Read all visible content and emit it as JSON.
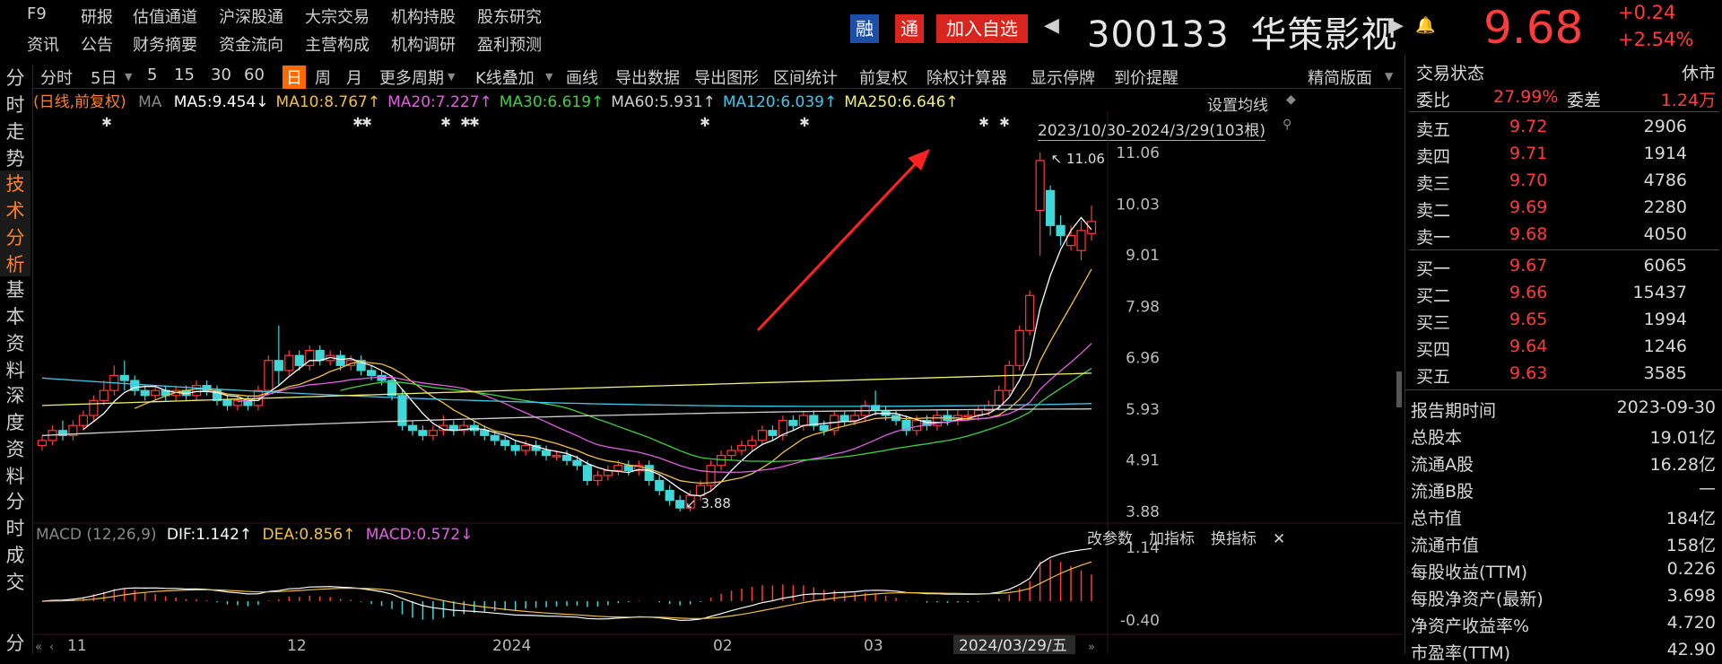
{
  "topnav": {
    "row1": [
      "F9",
      "研报",
      "估值通道",
      "沪深股通",
      "大宗交易",
      "机构持股",
      "股东研究"
    ],
    "row2": [
      "资讯",
      "公告",
      "财务摘要",
      "资金流向",
      "主营构成",
      "机构调研",
      "盈利预测"
    ]
  },
  "header": {
    "rong": "融",
    "tong": "通",
    "add_watch": "加入自选",
    "prev": "◀",
    "next": "▶",
    "bell": "🔔",
    "code": "300133",
    "name": "华策影视",
    "price": "9.68",
    "change": "+0.24",
    "change_pct": "+2.54%"
  },
  "lefttabs": [
    {
      "label": "分\n时\n走\n势",
      "active": false
    },
    {
      "label": "技\n术\n分\n析",
      "active": true
    },
    {
      "label": "基\n本\n资\n料",
      "active": false
    },
    {
      "label": "深\n度\n资\n料",
      "active": false
    },
    {
      "label": "分\n时\n成\n交",
      "active": false
    },
    {
      "label": "分",
      "active": false
    }
  ],
  "toolbar": {
    "items": [
      "分时",
      "5日",
      "5",
      "15",
      "30",
      "60",
      "日",
      "周",
      "月",
      "更多周期",
      "K线叠加",
      "画线",
      "导出数据",
      "导出图形",
      "区间统计",
      "前复权",
      "除权计算器",
      "显示停牌",
      "到价提醒"
    ],
    "active": "日",
    "right_label": "精简版面"
  },
  "ma": {
    "prefix": "(日线,前复权)",
    "ma": "MA",
    "items": [
      {
        "text": "MA5:9.454↓",
        "color": "#ffffff"
      },
      {
        "text": "MA10:8.767↑",
        "color": "#f0c040"
      },
      {
        "text": "MA20:7.227↑",
        "color": "#e060e0"
      },
      {
        "text": "MA30:6.619↑",
        "color": "#40d040"
      },
      {
        "text": "MA60:5.931↑",
        "color": "#d0d0d0"
      },
      {
        "text": "MA120:6.039↑",
        "color": "#40c8e8"
      },
      {
        "text": "MA250:6.646↑",
        "color": "#f0f070"
      }
    ],
    "settings": "设置均线",
    "range": "2023/10/30-2024/3/29(103根)"
  },
  "chart_data": {
    "type": "candlestick",
    "y_ticks": [
      "11.06",
      "10.03",
      "9.01",
      "7.98",
      "6.96",
      "5.93",
      "4.91",
      "3.88"
    ],
    "ylim": [
      3.88,
      11.06
    ],
    "high_label": "11.06",
    "low_label": "3.88",
    "x_labels": [
      "11",
      "12",
      "2024",
      "02",
      "03",
      "2024/03/29/五"
    ],
    "candles": [
      [
        5.2,
        5.3,
        5.1,
        5.4
      ],
      [
        5.3,
        5.5,
        5.2,
        5.6
      ],
      [
        5.5,
        5.4,
        5.3,
        5.7
      ],
      [
        5.4,
        5.6,
        5.3,
        5.7
      ],
      [
        5.6,
        5.8,
        5.5,
        5.9
      ],
      [
        5.8,
        6.1,
        5.7,
        6.2
      ],
      [
        6.1,
        6.3,
        6.0,
        6.5
      ],
      [
        6.3,
        6.6,
        6.2,
        6.8
      ],
      [
        6.6,
        6.5,
        6.3,
        6.9
      ],
      [
        6.5,
        6.3,
        6.2,
        6.6
      ],
      [
        6.3,
        6.2,
        6.1,
        6.4
      ],
      [
        6.2,
        6.3,
        6.1,
        6.4
      ],
      [
        6.3,
        6.2,
        6.1,
        6.4
      ],
      [
        6.2,
        6.3,
        6.1,
        6.4
      ],
      [
        6.3,
        6.2,
        6.1,
        6.4
      ],
      [
        6.2,
        6.4,
        6.1,
        6.5
      ],
      [
        6.4,
        6.3,
        6.2,
        6.5
      ],
      [
        6.3,
        6.1,
        6.0,
        6.4
      ],
      [
        6.1,
        6.0,
        5.9,
        6.2
      ],
      [
        6.0,
        6.1,
        5.9,
        6.2
      ],
      [
        6.1,
        6.0,
        5.9,
        6.2
      ],
      [
        6.0,
        6.3,
        5.9,
        6.4
      ],
      [
        6.3,
        6.9,
        6.2,
        7.0
      ],
      [
        6.9,
        6.7,
        6.4,
        7.6
      ],
      [
        6.7,
        7.0,
        6.6,
        7.1
      ],
      [
        7.0,
        6.8,
        6.7,
        7.1
      ],
      [
        6.8,
        7.1,
        6.7,
        7.2
      ],
      [
        7.1,
        6.9,
        6.8,
        7.2
      ],
      [
        6.9,
        7.0,
        6.8,
        7.1
      ],
      [
        7.0,
        6.8,
        6.7,
        7.1
      ],
      [
        6.8,
        6.9,
        6.7,
        7.0
      ],
      [
        6.9,
        6.7,
        6.6,
        7.0
      ],
      [
        6.7,
        6.6,
        6.5,
        6.8
      ],
      [
        6.6,
        6.5,
        6.4,
        6.7
      ],
      [
        6.5,
        6.2,
        6.1,
        6.6
      ],
      [
        6.2,
        5.6,
        5.5,
        6.3
      ],
      [
        5.6,
        5.5,
        5.4,
        5.7
      ],
      [
        5.5,
        5.4,
        5.3,
        5.6
      ],
      [
        5.4,
        5.5,
        5.3,
        5.6
      ],
      [
        5.5,
        5.6,
        5.4,
        5.8
      ],
      [
        5.6,
        5.5,
        5.4,
        5.7
      ],
      [
        5.5,
        5.6,
        5.4,
        5.7
      ],
      [
        5.6,
        5.5,
        5.4,
        5.7
      ],
      [
        5.5,
        5.4,
        5.3,
        5.6
      ],
      [
        5.4,
        5.3,
        5.2,
        5.5
      ],
      [
        5.3,
        5.2,
        5.1,
        5.4
      ],
      [
        5.2,
        5.1,
        5.0,
        5.3
      ],
      [
        5.1,
        5.2,
        5.0,
        5.3
      ],
      [
        5.2,
        5.1,
        5.0,
        5.3
      ],
      [
        5.1,
        5.0,
        4.9,
        5.2
      ],
      [
        5.0,
        5.0,
        4.9,
        5.1
      ],
      [
        5.0,
        4.9,
        4.8,
        5.1
      ],
      [
        4.9,
        4.8,
        4.7,
        5.0
      ],
      [
        4.8,
        4.5,
        4.4,
        4.9
      ],
      [
        4.5,
        4.6,
        4.4,
        4.7
      ],
      [
        4.6,
        4.7,
        4.5,
        4.8
      ],
      [
        4.7,
        4.8,
        4.6,
        4.9
      ],
      [
        4.8,
        4.7,
        4.6,
        4.9
      ],
      [
        4.7,
        4.8,
        4.6,
        4.9
      ],
      [
        4.8,
        4.5,
        4.4,
        4.9
      ],
      [
        4.5,
        4.3,
        4.2,
        4.6
      ],
      [
        4.3,
        4.1,
        4.0,
        4.4
      ],
      [
        4.1,
        3.95,
        3.88,
        4.2
      ],
      [
        3.95,
        4.2,
        3.88,
        4.3
      ],
      [
        4.2,
        4.4,
        4.1,
        4.5
      ],
      [
        4.4,
        4.8,
        4.3,
        4.9
      ],
      [
        4.8,
        5.0,
        4.7,
        5.1
      ],
      [
        5.0,
        5.1,
        4.9,
        5.2
      ],
      [
        5.1,
        5.2,
        5.0,
        5.3
      ],
      [
        5.2,
        5.3,
        5.1,
        5.4
      ],
      [
        5.3,
        5.5,
        5.2,
        5.6
      ],
      [
        5.5,
        5.4,
        5.3,
        5.6
      ],
      [
        5.4,
        5.7,
        5.3,
        5.8
      ],
      [
        5.7,
        5.6,
        5.5,
        5.8
      ],
      [
        5.6,
        5.8,
        5.5,
        5.9
      ],
      [
        5.8,
        5.6,
        5.5,
        5.9
      ],
      [
        5.6,
        5.5,
        5.4,
        5.7
      ],
      [
        5.5,
        5.8,
        5.4,
        5.9
      ],
      [
        5.8,
        5.7,
        5.6,
        5.9
      ],
      [
        5.7,
        5.8,
        5.6,
        5.9
      ],
      [
        5.8,
        6.0,
        5.7,
        6.1
      ],
      [
        6.0,
        5.9,
        5.8,
        6.3
      ],
      [
        5.9,
        5.8,
        5.7,
        6.0
      ],
      [
        5.8,
        5.7,
        5.6,
        5.9
      ],
      [
        5.7,
        5.5,
        5.4,
        5.8
      ],
      [
        5.5,
        5.7,
        5.4,
        5.8
      ],
      [
        5.7,
        5.6,
        5.5,
        5.8
      ],
      [
        5.6,
        5.8,
        5.5,
        5.9
      ],
      [
        5.8,
        5.7,
        5.6,
        5.9
      ],
      [
        5.7,
        5.8,
        5.6,
        5.9
      ],
      [
        5.8,
        5.8,
        5.7,
        5.9
      ],
      [
        5.8,
        5.9,
        5.7,
        6.0
      ],
      [
        5.9,
        6.0,
        5.8,
        6.1
      ],
      [
        6.0,
        6.3,
        5.9,
        6.4
      ],
      [
        6.3,
        6.8,
        6.2,
        6.9
      ],
      [
        6.8,
        7.5,
        6.7,
        7.6
      ],
      [
        7.5,
        8.2,
        7.4,
        8.3
      ],
      [
        9.9,
        10.9,
        9.0,
        11.06
      ],
      [
        10.3,
        9.6,
        9.4,
        10.4
      ],
      [
        9.6,
        9.4,
        9.2,
        9.8
      ],
      [
        9.2,
        9.4,
        9.1,
        9.6
      ],
      [
        9.1,
        9.5,
        8.9,
        9.7
      ],
      [
        9.44,
        9.68,
        9.3,
        10.0
      ]
    ],
    "ma5_last": 9.454,
    "ma10_last": 8.767,
    "ma20_last": 7.227,
    "ma30_last": 6.619,
    "ma60_last": 5.931,
    "ma120_last": 6.039,
    "ma250_last": 6.646
  },
  "macd": {
    "label": "MACD (12,26,9)",
    "dif": "DIF:1.142↑",
    "dea": "DEA:0.856↑",
    "macd": "MACD:0.572↓",
    "buttons": [
      "改参数",
      "加指标",
      "换指标"
    ],
    "close": "✕",
    "y_ticks": [
      "1.14",
      "-0.40"
    ]
  },
  "right": {
    "status_label": "交易状态",
    "status_value": "休市",
    "webi_label": "委比",
    "webi_value": "27.99%",
    "weicha_label": "委差",
    "weicha_value": "1.24万",
    "asks": [
      {
        "label": "卖五",
        "price": "9.72",
        "vol": "2906"
      },
      {
        "label": "卖四",
        "price": "9.71",
        "vol": "1914"
      },
      {
        "label": "卖三",
        "price": "9.70",
        "vol": "4786"
      },
      {
        "label": "卖二",
        "price": "9.69",
        "vol": "2280"
      },
      {
        "label": "卖一",
        "price": "9.68",
        "vol": "4050"
      }
    ],
    "bids": [
      {
        "label": "买一",
        "price": "9.67",
        "vol": "6065"
      },
      {
        "label": "买二",
        "price": "9.66",
        "vol": "15437"
      },
      {
        "label": "买三",
        "price": "9.65",
        "vol": "1994"
      },
      {
        "label": "买四",
        "price": "9.64",
        "vol": "1246"
      },
      {
        "label": "买五",
        "price": "9.63",
        "vol": "3585"
      }
    ],
    "fundamentals": [
      {
        "label": "报告期时间",
        "value": "2023-09-30"
      },
      {
        "label": "总股本",
        "value": "19.01亿"
      },
      {
        "label": "流通A股",
        "value": "16.28亿"
      },
      {
        "label": "流通B股",
        "value": "—"
      },
      {
        "label": "总市值",
        "value": "184亿"
      },
      {
        "label": "流通市值",
        "value": "158亿"
      },
      {
        "label": "每股收益(TTM)",
        "value": "0.226"
      },
      {
        "label": "每股净资产(最新)",
        "value": "3.698"
      },
      {
        "label": "净资产收益率%",
        "value": "4.720"
      },
      {
        "label": "市盈率(TTM)",
        "value": "42.90"
      }
    ]
  },
  "colors": {
    "up": "#ff3b3b",
    "down": "#3fd7d7",
    "accent": "#ff6a00",
    "bg": "#000000"
  }
}
